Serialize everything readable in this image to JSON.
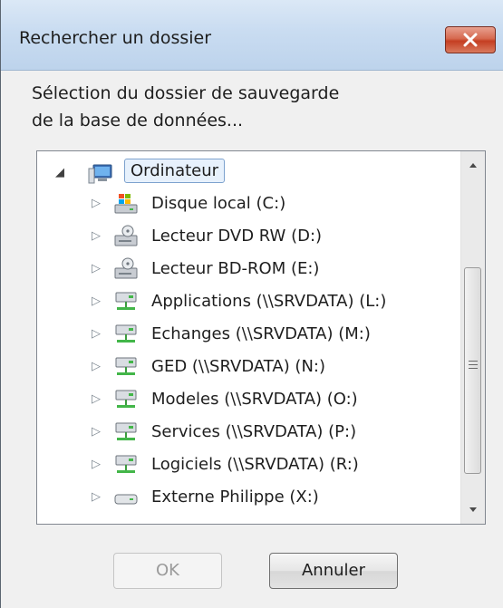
{
  "dialog": {
    "title": "Rechercher un dossier",
    "prompt_line1": "Sélection du dossier de sauvegarde",
    "prompt_line2": "de la base de données..."
  },
  "tree": {
    "root": {
      "label": "Ordinateur",
      "icon": "computer-icon",
      "expanded": true,
      "selected": true
    },
    "items": [
      {
        "label": "Disque local (C:)",
        "icon": "windows-drive-icon"
      },
      {
        "label": "Lecteur DVD RW (D:)",
        "icon": "optical-drive-icon"
      },
      {
        "label": "Lecteur BD-ROM (E:)",
        "icon": "optical-drive-icon"
      },
      {
        "label": "Applications (\\\\SRVDATA) (L:)",
        "icon": "network-drive-icon"
      },
      {
        "label": "Echanges (\\\\SRVDATA) (M:)",
        "icon": "network-drive-icon"
      },
      {
        "label": "GED (\\\\SRVDATA) (N:)",
        "icon": "network-drive-icon"
      },
      {
        "label": "Modeles (\\\\SRVDATA) (O:)",
        "icon": "network-drive-icon"
      },
      {
        "label": "Services (\\\\SRVDATA) (P:)",
        "icon": "network-drive-icon"
      },
      {
        "label": "Logiciels (\\\\SRVDATA) (R:)",
        "icon": "network-drive-icon"
      },
      {
        "label": "Externe Philippe (X:)",
        "icon": "removable-drive-icon"
      }
    ]
  },
  "buttons": {
    "ok": "OK",
    "cancel": "Annuler",
    "ok_enabled": false
  },
  "colors": {
    "titlebar": "#c9dcf1",
    "close": "#c43e22",
    "selection": "#e7f1fc"
  }
}
